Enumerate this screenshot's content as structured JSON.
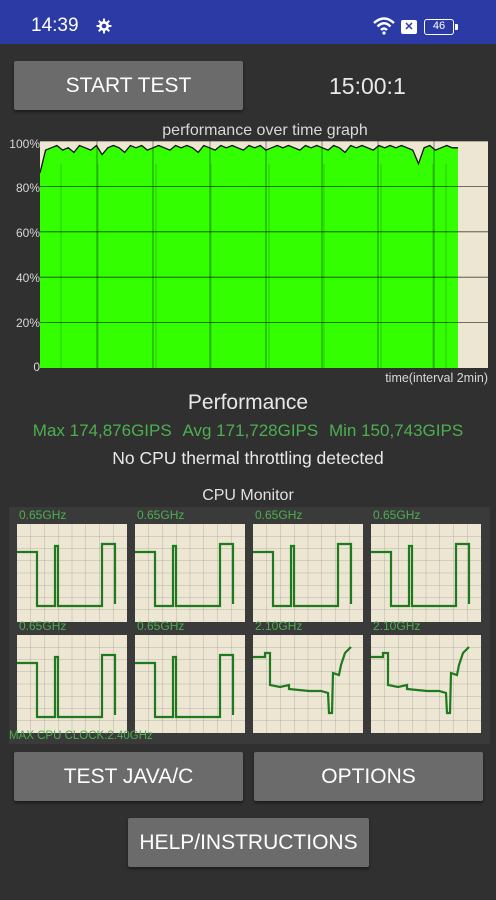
{
  "status_bar": {
    "time": "14:39",
    "battery": "46",
    "icons": [
      "gear-icon",
      "wifi-icon",
      "notification-x-icon",
      "battery-icon"
    ]
  },
  "controls": {
    "start_label": "START TEST",
    "timer": "15:00:1",
    "java_label": "TEST JAVA/C",
    "options_label": "OPTIONS",
    "help_label": "HELP/INSTRUCTIONS"
  },
  "graph": {
    "title": "performance over time graph",
    "y_ticks": [
      "100%",
      "80%",
      "60%",
      "40%",
      "20%",
      "0"
    ],
    "xlabel": "time(interval 2min)",
    "fill_color": "#33ff00",
    "bg_color": "#ede6d3"
  },
  "performance": {
    "title": "Performance",
    "max": "Max 174,876GIPS",
    "avg": "Avg 171,728GIPS",
    "min": "Min 150,743GIPS",
    "throttle": "No CPU thermal throttling detected"
  },
  "cpu": {
    "title": "CPU Monitor",
    "max_clock": "MAX CPU CLOCK:2.40GHz",
    "cores": [
      {
        "freq": "0.65GHz"
      },
      {
        "freq": "0.65GHz"
      },
      {
        "freq": "0.65GHz"
      },
      {
        "freq": "0.65GHz"
      },
      {
        "freq": "0.65GHz"
      },
      {
        "freq": "0.65GHz"
      },
      {
        "freq": "2.10GHz"
      },
      {
        "freq": "2.10GHz"
      }
    ]
  },
  "chart_data": {
    "type": "area",
    "title": "performance over time graph",
    "xlabel": "time(interval 2min)",
    "ylabel": "",
    "ylim": [
      0,
      100
    ],
    "y_unit": "%",
    "y_ticks": [
      0,
      20,
      40,
      60,
      80,
      100
    ],
    "grid": true,
    "x": [
      0,
      0.1,
      0.2,
      0.3,
      0.4,
      0.5,
      0.6,
      0.7,
      0.8,
      0.9,
      1.0,
      1.1,
      1.2,
      1.3,
      1.4,
      1.5,
      1.6,
      1.7,
      1.8,
      1.9,
      2.0,
      2.1,
      2.2,
      2.3,
      2.4,
      2.5,
      2.6,
      2.7,
      2.8,
      2.9,
      3.0,
      3.1,
      3.2,
      3.3,
      3.4,
      3.5,
      3.6,
      3.7,
      3.8,
      3.9,
      4.0,
      4.1,
      4.2,
      4.3,
      4.4,
      4.5,
      4.6,
      4.7,
      4.8,
      4.9,
      5.0,
      5.1,
      5.2,
      5.3,
      5.4,
      5.5,
      5.6,
      5.7,
      5.8,
      5.9,
      6.0,
      6.1,
      6.2,
      6.3,
      6.4,
      6.5,
      6.6,
      6.7,
      6.8,
      6.9,
      7.0,
      7.1,
      7.2,
      7.3,
      7.4
    ],
    "series": [
      {
        "values": [
          86,
          96,
          97,
          98,
          96,
          97,
          95,
          98,
          97,
          96,
          98,
          94,
          97,
          98,
          97,
          95,
          98,
          97,
          98,
          96,
          97,
          98,
          97,
          96,
          98,
          97,
          98,
          97,
          95,
          98,
          97,
          96,
          98,
          97,
          98,
          97,
          96,
          98,
          97,
          98,
          96,
          97,
          98,
          97,
          98,
          97,
          96,
          98,
          97,
          98,
          97,
          96,
          98,
          97,
          95,
          98,
          97,
          98,
          97,
          96,
          98,
          97,
          98,
          97,
          98,
          97,
          96,
          90,
          97,
          98,
          96,
          97,
          98,
          97,
          97
        ]
      }
    ]
  }
}
